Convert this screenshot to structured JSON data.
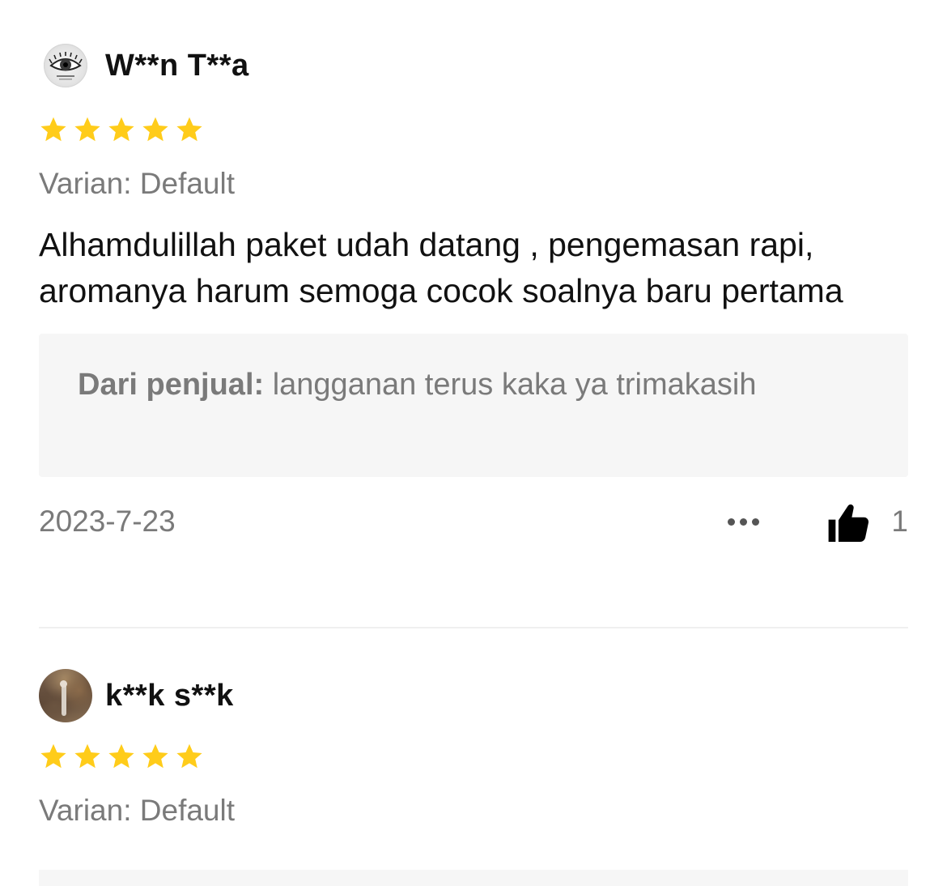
{
  "reviews": [
    {
      "username": "W**n T**a",
      "avatar": "eye-logo-avatar",
      "rating": 5,
      "variant": "Varian: Default",
      "comment": "Alhamdulillah paket udah datang , pengemasan rapi, aromanya harum semoga cocok soalnya baru pertama",
      "seller_reply": {
        "label": "Dari penjual:",
        "text": " langganan terus kaka ya trimakasih"
      },
      "date": "2023-7-23",
      "likes": "1"
    },
    {
      "username": "k**k s**k",
      "avatar": "photo-avatar",
      "rating": 5,
      "variant": "Varian: Default"
    }
  ],
  "colors": {
    "star": "#FFCC1A",
    "muted_text": "#7A7A7A",
    "reply_bg": "#F6F6F6"
  },
  "icons": {
    "star": "star-icon",
    "more": "more-dots-icon",
    "like": "thumbs-up-icon"
  }
}
